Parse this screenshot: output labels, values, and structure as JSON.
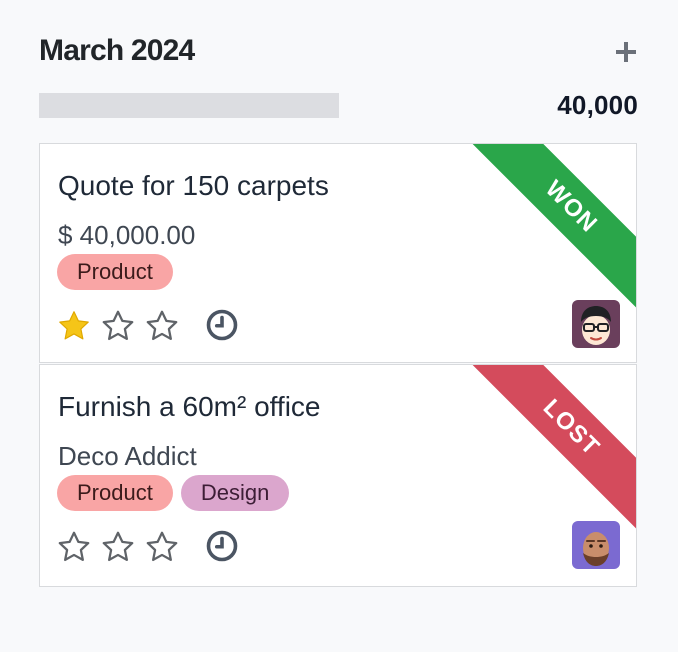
{
  "column": {
    "title": "March 2024",
    "total": "40,000",
    "add_icon": "plus-icon"
  },
  "cards": [
    {
      "title": "Quote for 150 carpets",
      "subtitle": "$ 40,000.00",
      "tags": [
        "Product"
      ],
      "ribbon": "WON",
      "ribbon_color": "#2aa64a",
      "priority_stars": 1,
      "activity_icon": "clock-icon",
      "avatar_icon": "user-avatar-glasses"
    },
    {
      "title": "Furnish a 60m² office",
      "subtitle": "Deco Addict",
      "tags": [
        "Product",
        "Design"
      ],
      "ribbon": "LOST",
      "ribbon_color": "#d44b5c",
      "priority_stars": 0,
      "activity_icon": "clock-icon",
      "avatar_icon": "user-avatar-beard"
    }
  ],
  "colors": {
    "star_filled": "#f5c518",
    "star_empty": "#5f6368",
    "tag_product": "#f9a5a5",
    "tag_design": "#dba6cd",
    "progress_track": "#dcdde1"
  }
}
